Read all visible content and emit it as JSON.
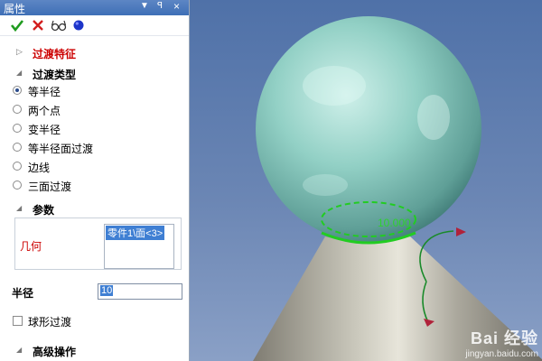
{
  "panel": {
    "title": "属性",
    "controls": {
      "dropdown": "▼",
      "pin": "ꟼ",
      "close": "×"
    },
    "toolbar": [
      {
        "name": "ok",
        "icon": "check-icon"
      },
      {
        "name": "cancel",
        "icon": "cross-icon"
      },
      {
        "name": "preview",
        "icon": "glasses-icon"
      },
      {
        "name": "apply",
        "icon": "blue-dot-icon"
      }
    ],
    "sections": {
      "feature": "过渡特征",
      "transition_type": "过渡类型",
      "params": "参数",
      "advanced": "高级操作"
    },
    "transition_options": [
      {
        "label": "等半径",
        "checked": true
      },
      {
        "label": "两个点",
        "checked": false
      },
      {
        "label": "变半径",
        "checked": false
      },
      {
        "label": "等半径面过渡",
        "checked": false
      },
      {
        "label": "边线",
        "checked": false
      },
      {
        "label": "三面过渡",
        "checked": false
      }
    ],
    "geometry": {
      "label": "几何",
      "selected_item": "零件1\\面<3>"
    },
    "radius": {
      "label": "半径",
      "value": "10"
    },
    "ball_transition": {
      "label": "球形过渡",
      "checked": false
    }
  },
  "viewport": {
    "dimension_label": "10.000",
    "colors": {
      "background_top": "#4f71a8",
      "sphere": "#8fcfc3",
      "cone": "#c4c2b6",
      "selection": "#22cc22",
      "arrow": "#b0223a"
    }
  },
  "watermark": {
    "brand": "Bai 经验",
    "url": "jingyan.baidu.com"
  }
}
